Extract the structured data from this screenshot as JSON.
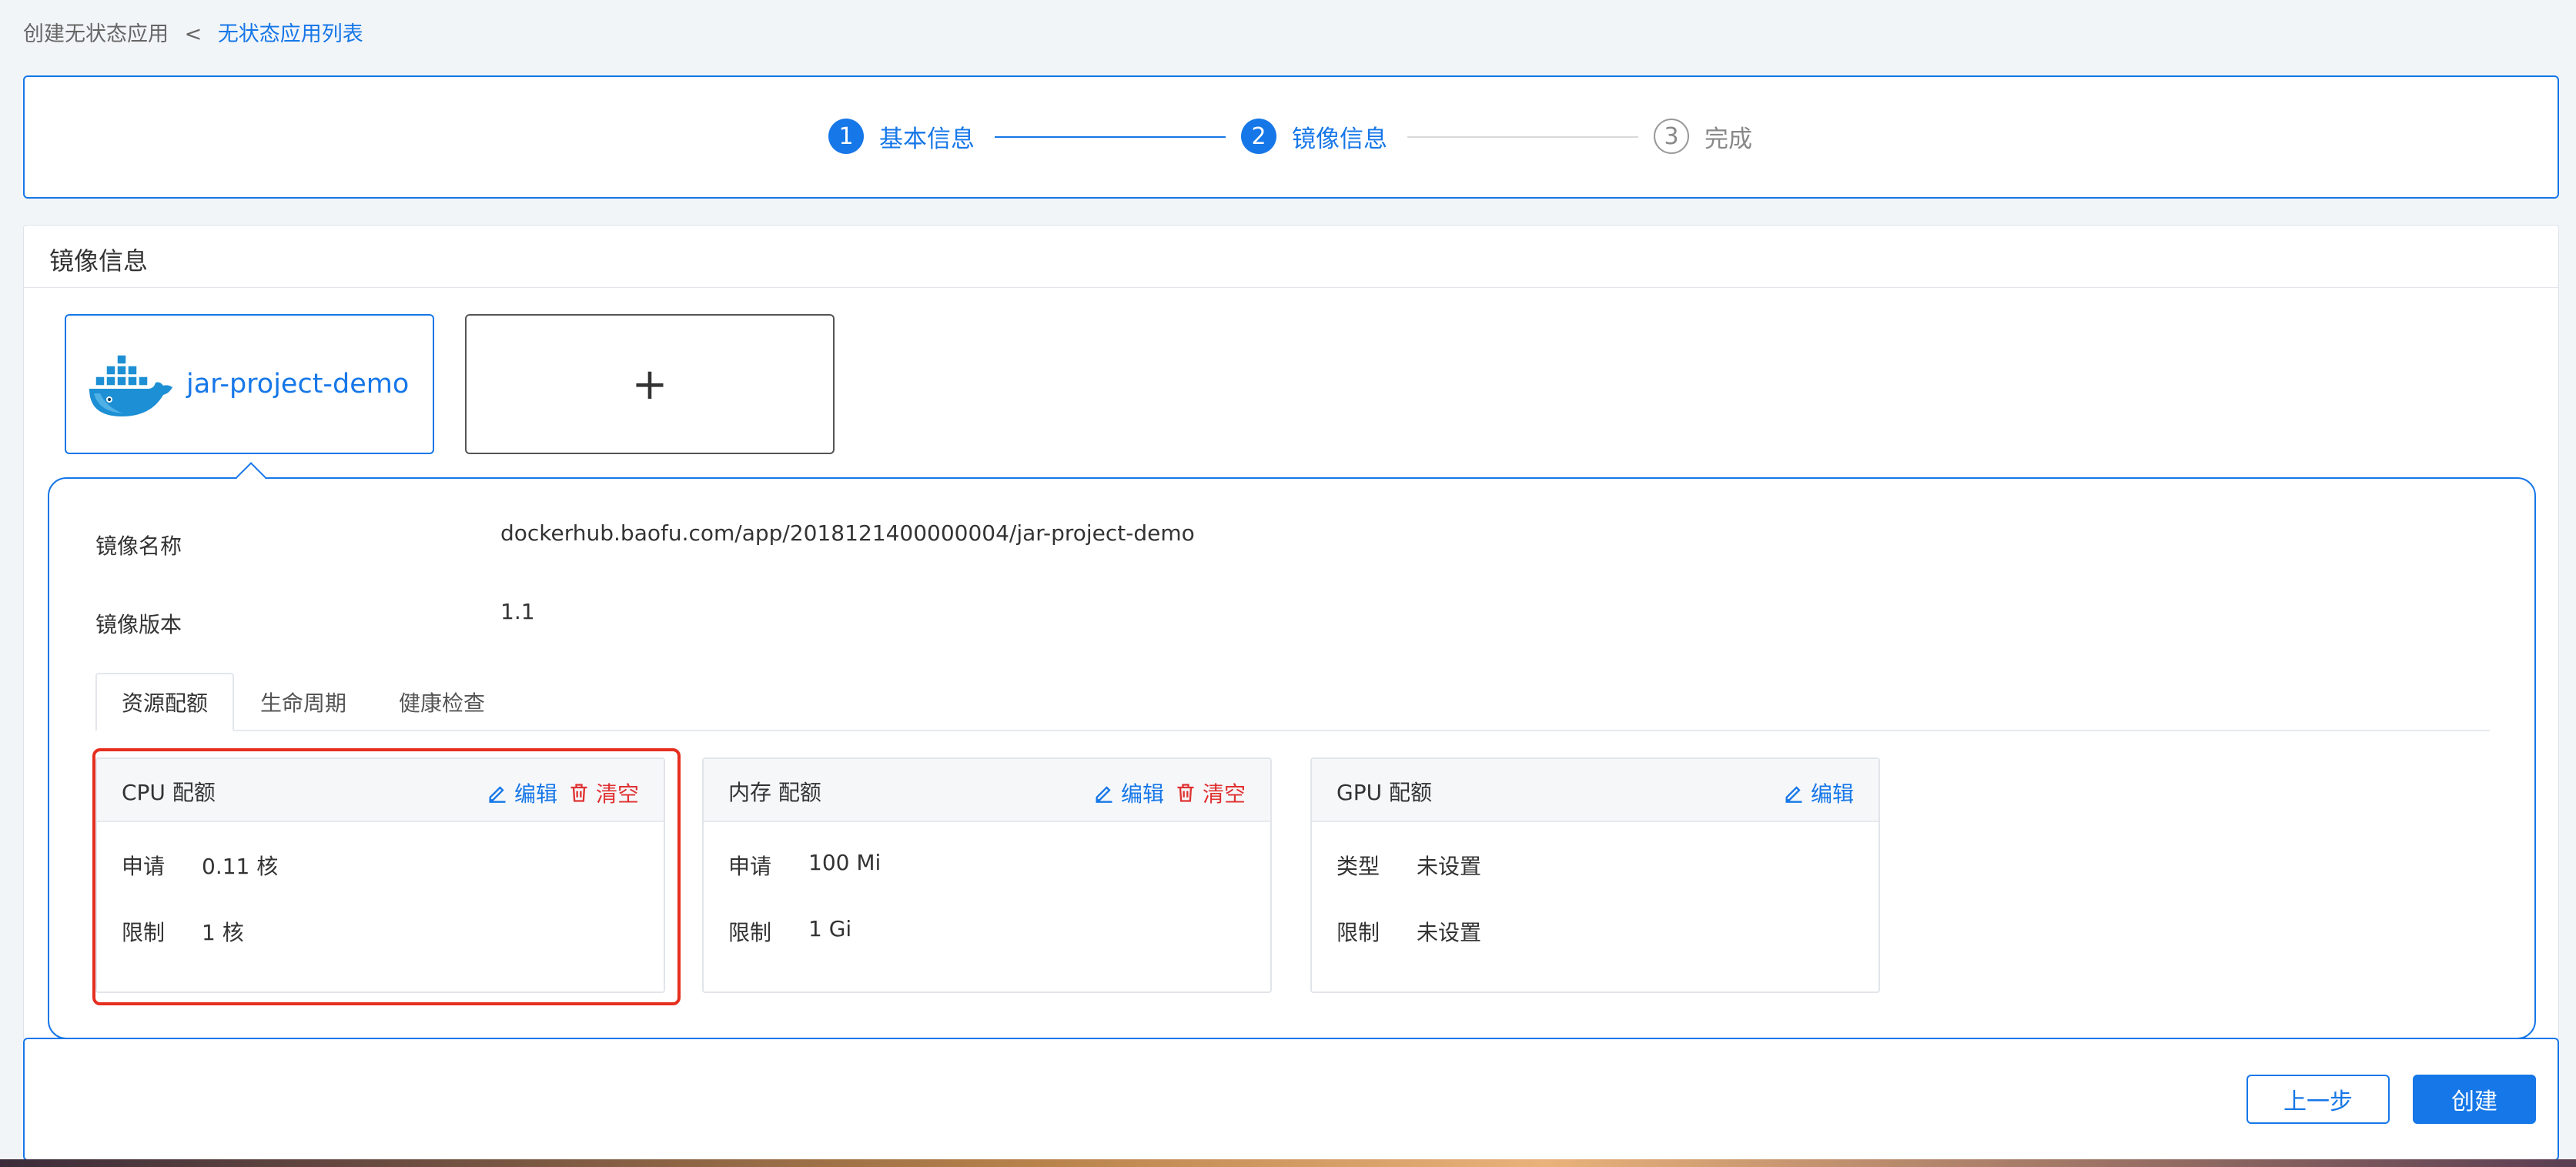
{
  "breadcrumb": {
    "current": "创建无状态应用",
    "separator": "<",
    "link": "无状态应用列表"
  },
  "steps": [
    {
      "num": "1",
      "label": "基本信息",
      "state": "active"
    },
    {
      "num": "2",
      "label": "镜像信息",
      "state": "active"
    },
    {
      "num": "3",
      "label": "完成",
      "state": "pending"
    }
  ],
  "section_title": "镜像信息",
  "image_card": {
    "name": "jar-project-demo",
    "icon": "docker-whale-icon"
  },
  "add_card": {
    "label": "+"
  },
  "detail": {
    "image_name_label": "镜像名称",
    "image_name_value": "dockerhub.baofu.com/app/2018121400000004/jar-project-demo",
    "image_version_label": "镜像版本",
    "image_version_value": "1.1"
  },
  "tabs": [
    "资源配额",
    "生命周期",
    "健康检查"
  ],
  "resources": {
    "cpu": {
      "title": "CPU 配额",
      "edit": "编辑",
      "clear": "清空",
      "request_label": "申请",
      "request_value": "0.11 核",
      "limit_label": "限制",
      "limit_value": "1 核"
    },
    "memory": {
      "title": "内存 配额",
      "edit": "编辑",
      "clear": "清空",
      "request_label": "申请",
      "request_value": "100 Mi",
      "limit_label": "限制",
      "limit_value": "1 Gi"
    },
    "gpu": {
      "title": "GPU 配额",
      "edit": "编辑",
      "type_label": "类型",
      "type_value": "未设置",
      "limit_label": "限制",
      "limit_value": "未设置"
    }
  },
  "footer": {
    "prev": "上一步",
    "create": "创建"
  },
  "colors": {
    "primary": "#1677e8",
    "danger": "#e03131",
    "highlight": "#e62e1f"
  }
}
